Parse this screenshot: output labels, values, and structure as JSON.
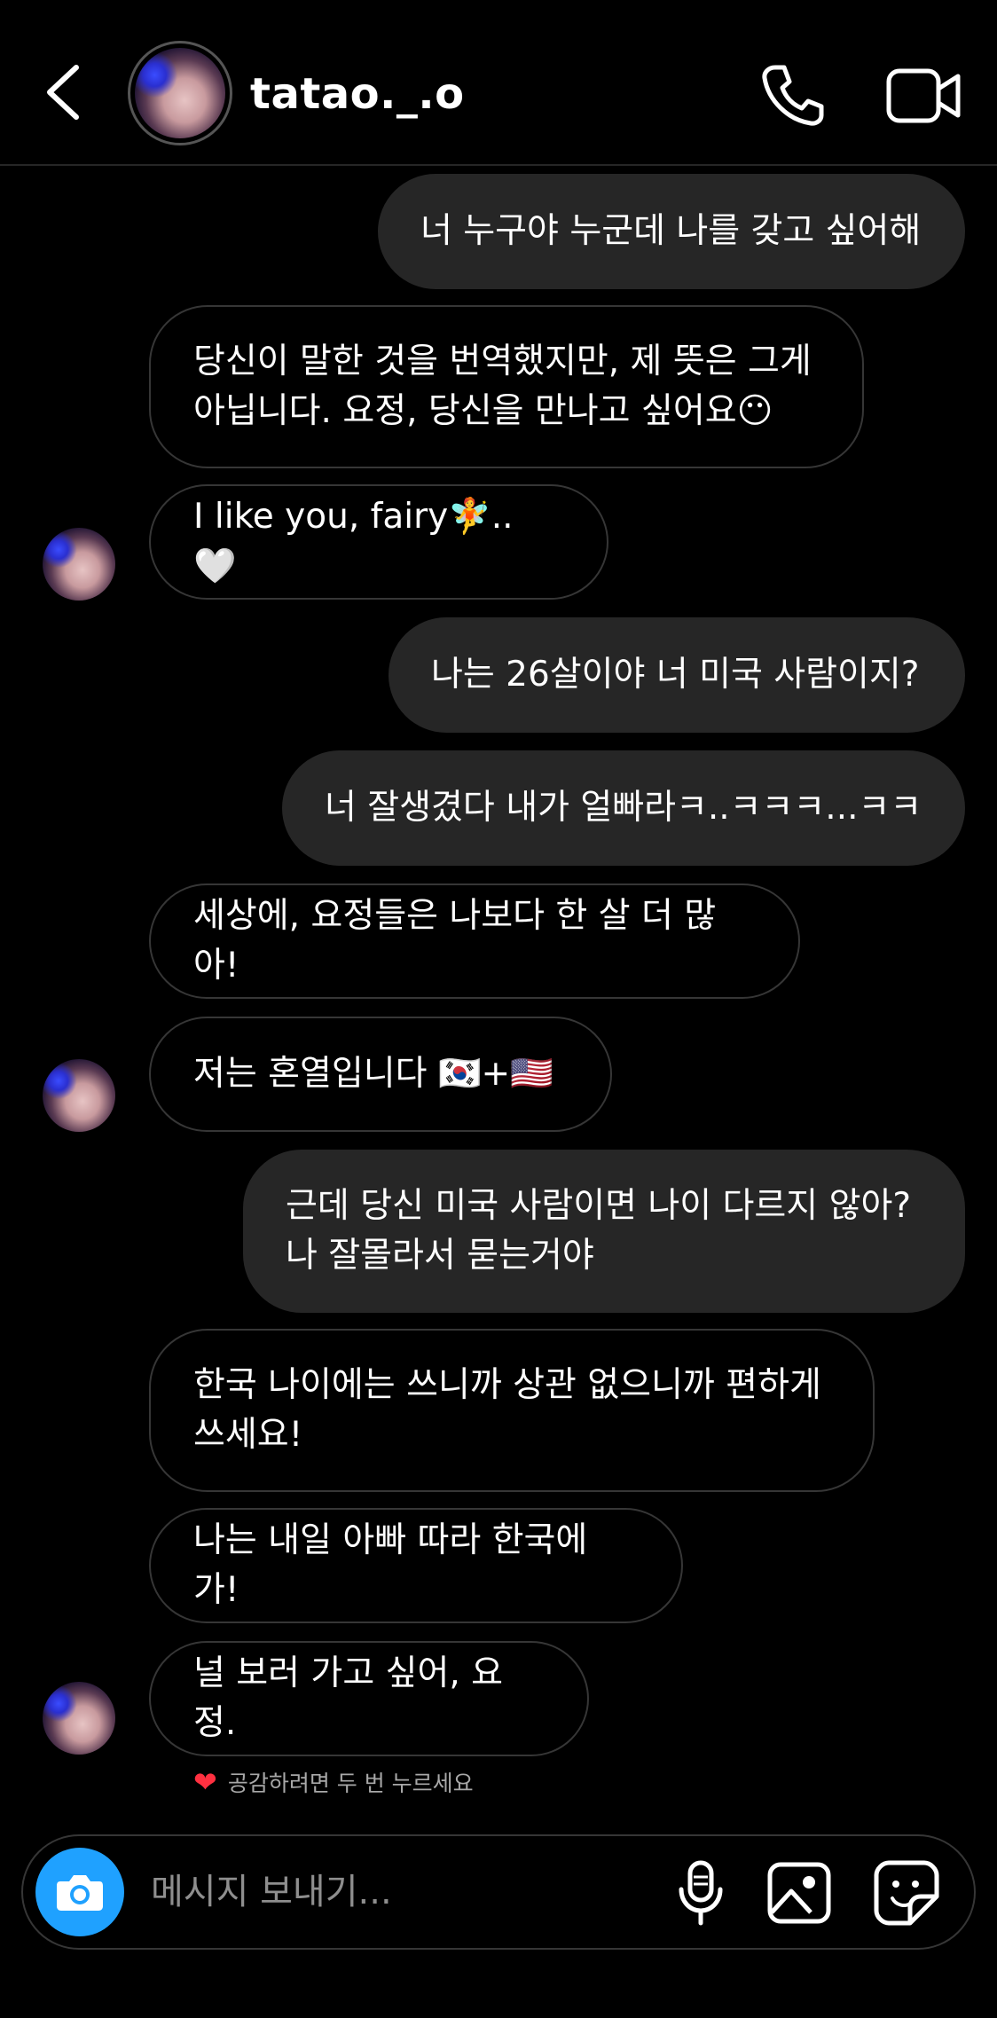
{
  "header": {
    "username": "tatao._.o",
    "icons": [
      "back-icon",
      "avatar",
      "phone-icon",
      "video-icon"
    ]
  },
  "messages": [
    {
      "side": "sent",
      "text": "너 누구야 누군데 나를 갖고 싶어해"
    },
    {
      "side": "received",
      "text": "당신이 말한 것을 번역했지만, 제 뜻은 그게\n아닙니다. 요정, 당신을 만나고 싶어요😶"
    },
    {
      "side": "received",
      "text": "I like you, fairy🧚.. 🤍"
    },
    {
      "side": "sent",
      "text": "나는 26살이야 너 미국 사람이지?"
    },
    {
      "side": "sent",
      "text": "너 잘생겼다 내가 얼빠라ㅋ..ㅋㅋㅋ...ㅋㅋ"
    },
    {
      "side": "received",
      "text": "세상에, 요정들은 나보다 한 살 더 많아!"
    },
    {
      "side": "received",
      "text": "저는 혼열입니다 🇰🇷+🇺🇸"
    },
    {
      "side": "sent",
      "text": "근데 당신 미국 사람이면 나이 다르지 않아?\n나 잘몰라서 묻는거야"
    },
    {
      "side": "received",
      "text": "한국 나이에는 쓰니까 상관 없으니까 편하게\n쓰세요!"
    },
    {
      "side": "received",
      "text": "나는 내일 아빠 따라 한국에 가!"
    },
    {
      "side": "received",
      "text": "널 보러 가고 싶어, 요정."
    }
  ],
  "reaction_hint": {
    "heart": "❤",
    "text": "공감하려면 두 번 누르세요"
  },
  "composer": {
    "placeholder": "메시지 보내기..."
  },
  "colors": {
    "background": "#000000",
    "sent_bubble": "#262626",
    "camera_button": "#1fa1ff"
  }
}
